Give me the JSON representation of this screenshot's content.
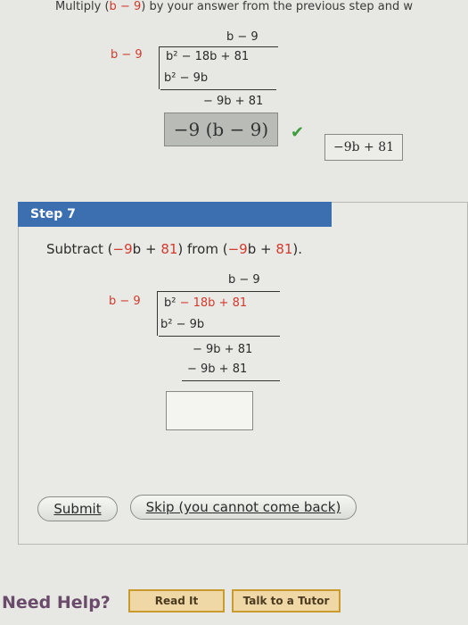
{
  "header": {
    "prefix": "Multiply (",
    "b": "b",
    "minus9": " − 9",
    "suffix": ") by your answer from the previous step and w"
  },
  "prev_division": {
    "divisor": "b − 9",
    "quotient": "b − 9",
    "dividend": "b² − 18b + 81",
    "sub_line": "b² − 9b",
    "remainder_line": "− 9b  + 81"
  },
  "prev_answer": {
    "entered": "−9 (b − 9)",
    "check": "✔",
    "correct": "−9b + 81"
  },
  "step": {
    "title": "Step 7",
    "instruction_prefix": "Subtract (",
    "instr_neg9": "−9",
    "instr_b1": "b",
    "instr_plus": " + ",
    "instr_81": "81",
    "instr_mid": ") from (",
    "instr_neg9b": "−9",
    "instr_b2": "b",
    "instr_plus2": " + ",
    "instr_81b": "81",
    "instr_end": ")."
  },
  "division": {
    "divisor": "b − 9",
    "quotient": "b − 9",
    "dividend_b2": "b²",
    "dividend_rest": " − 18b + 81",
    "line2": "b² − 9b",
    "line3": "− 9b  + 81",
    "line4": "− 9b  + 81"
  },
  "buttons": {
    "submit": "Submit",
    "skip": "Skip (you cannot come back)"
  },
  "help": {
    "label": "Need Help?",
    "read": "Read It",
    "talk": "Talk to a Tutor"
  }
}
